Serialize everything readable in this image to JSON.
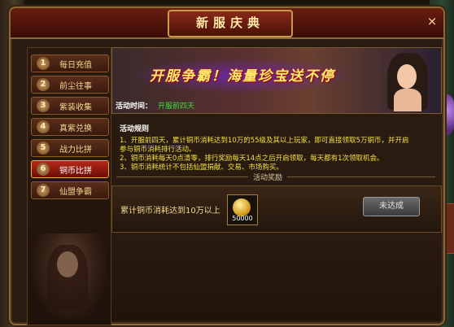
{
  "window": {
    "title": "新服庆典",
    "close_glyph": "×"
  },
  "sidebar": {
    "items": [
      {
        "num": "1",
        "label": "每日充值"
      },
      {
        "num": "2",
        "label": "前尘往事"
      },
      {
        "num": "3",
        "label": "紫装收集"
      },
      {
        "num": "4",
        "label": "真紫兑换"
      },
      {
        "num": "5",
        "label": "战力比拼"
      },
      {
        "num": "6",
        "label": "铜币比拼"
      },
      {
        "num": "7",
        "label": "仙盟争霸"
      }
    ],
    "active_index": 5
  },
  "banner": {
    "title": "开服争霸！海量珍宝送不停",
    "time_label": "活动时间：",
    "time_value": "开服前四天"
  },
  "rules": {
    "heading": "活动规则",
    "lines": [
      "1、开服前四天，累计铜币消耗达到10万的55级及其以上玩家，即可直接领取5万铜币，并开启",
      "参与铜币消耗排行活动。",
      "2、铜币消耗每天0点清零，排行奖励每天14点之后开启领取，每天都有1次领取机会。",
      "3、铜币消耗统计不包括仙盟捐献、交易、市场购买。"
    ]
  },
  "reward": {
    "section_label": "活动奖励",
    "description": "累计铜币消耗达到10万以上",
    "item_amount": "50000",
    "button_label": "未达成"
  },
  "colors": {
    "accent_gold": "#f2d890",
    "rule_text": "#f0e040",
    "time_value": "#38e038",
    "active_tab": "#b82818"
  }
}
